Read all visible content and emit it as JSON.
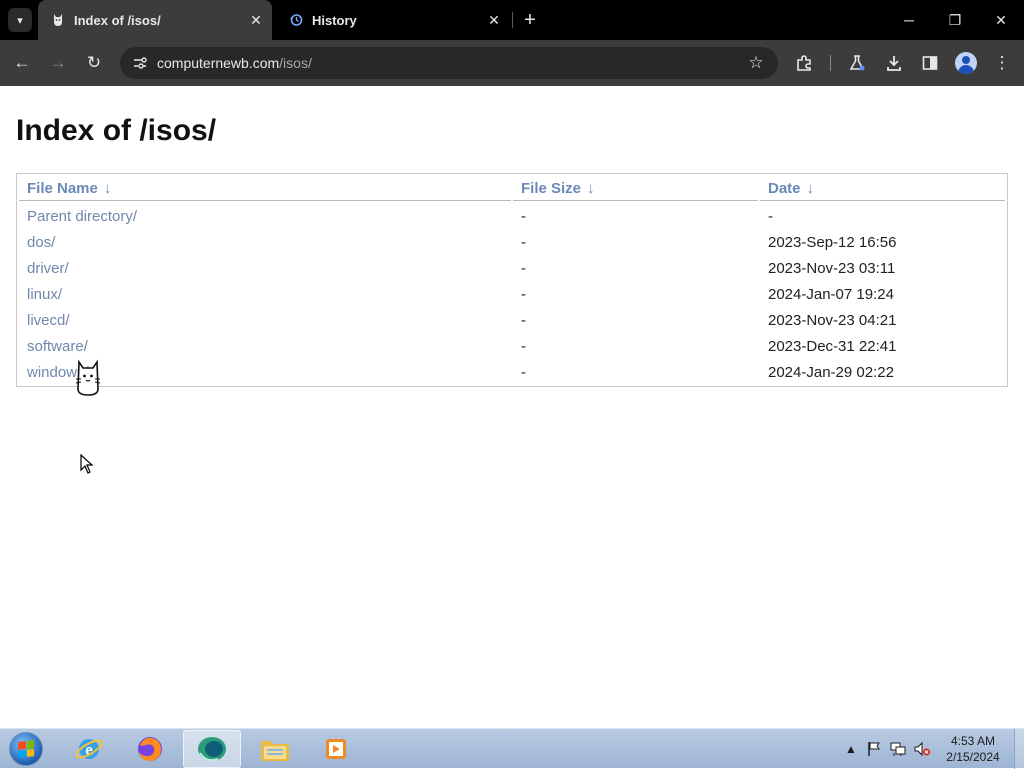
{
  "browser": {
    "tabs": [
      {
        "title": "Index of /isos/",
        "icon": "cat-favicon-icon",
        "active": true
      },
      {
        "title": "History",
        "icon": "history-icon",
        "active": false
      }
    ],
    "url_host": "computernewb.com",
    "url_path": "/isos/",
    "window_controls": {
      "minimize": "─",
      "restore": "❐",
      "close": "✕"
    },
    "icons": {
      "tab_search": "▾",
      "tab_close": "✕",
      "new_tab": "+",
      "back": "←",
      "forward": "→",
      "reload": "↻",
      "bookmark": "☆",
      "menu": "⋮"
    }
  },
  "page": {
    "heading": "Index of /isos/",
    "columns": {
      "name": "File Name",
      "size": "File Size",
      "date": "Date",
      "sort_arrow": "↓"
    },
    "rows": [
      {
        "name": "Parent directory/",
        "size": "-",
        "date": "-"
      },
      {
        "name": "dos/",
        "size": "-",
        "date": "2023-Sep-12 16:56"
      },
      {
        "name": "driver/",
        "size": "-",
        "date": "2023-Nov-23 03:11"
      },
      {
        "name": "linux/",
        "size": "-",
        "date": "2024-Jan-07 19:24"
      },
      {
        "name": "livecd/",
        "size": "-",
        "date": "2023-Nov-23 04:21"
      },
      {
        "name": "software/",
        "size": "-",
        "date": "2023-Dec-31 22:41"
      },
      {
        "name": "windows/",
        "size": "-",
        "date": "2024-Jan-29 02:22"
      }
    ]
  },
  "taskbar": {
    "apps": [
      "internet-explorer",
      "firefox",
      "chromium-browser",
      "file-explorer",
      "media-player"
    ],
    "active_app": "chromium-browser",
    "tray_arrow": "▲",
    "time": "4:53 AM",
    "date": "2/15/2024"
  },
  "colors": {
    "link": "#7187ad",
    "header_link": "#6b89b8",
    "chrome_dark": "#3c3c3c",
    "taskbar": "#b9cbe2"
  }
}
